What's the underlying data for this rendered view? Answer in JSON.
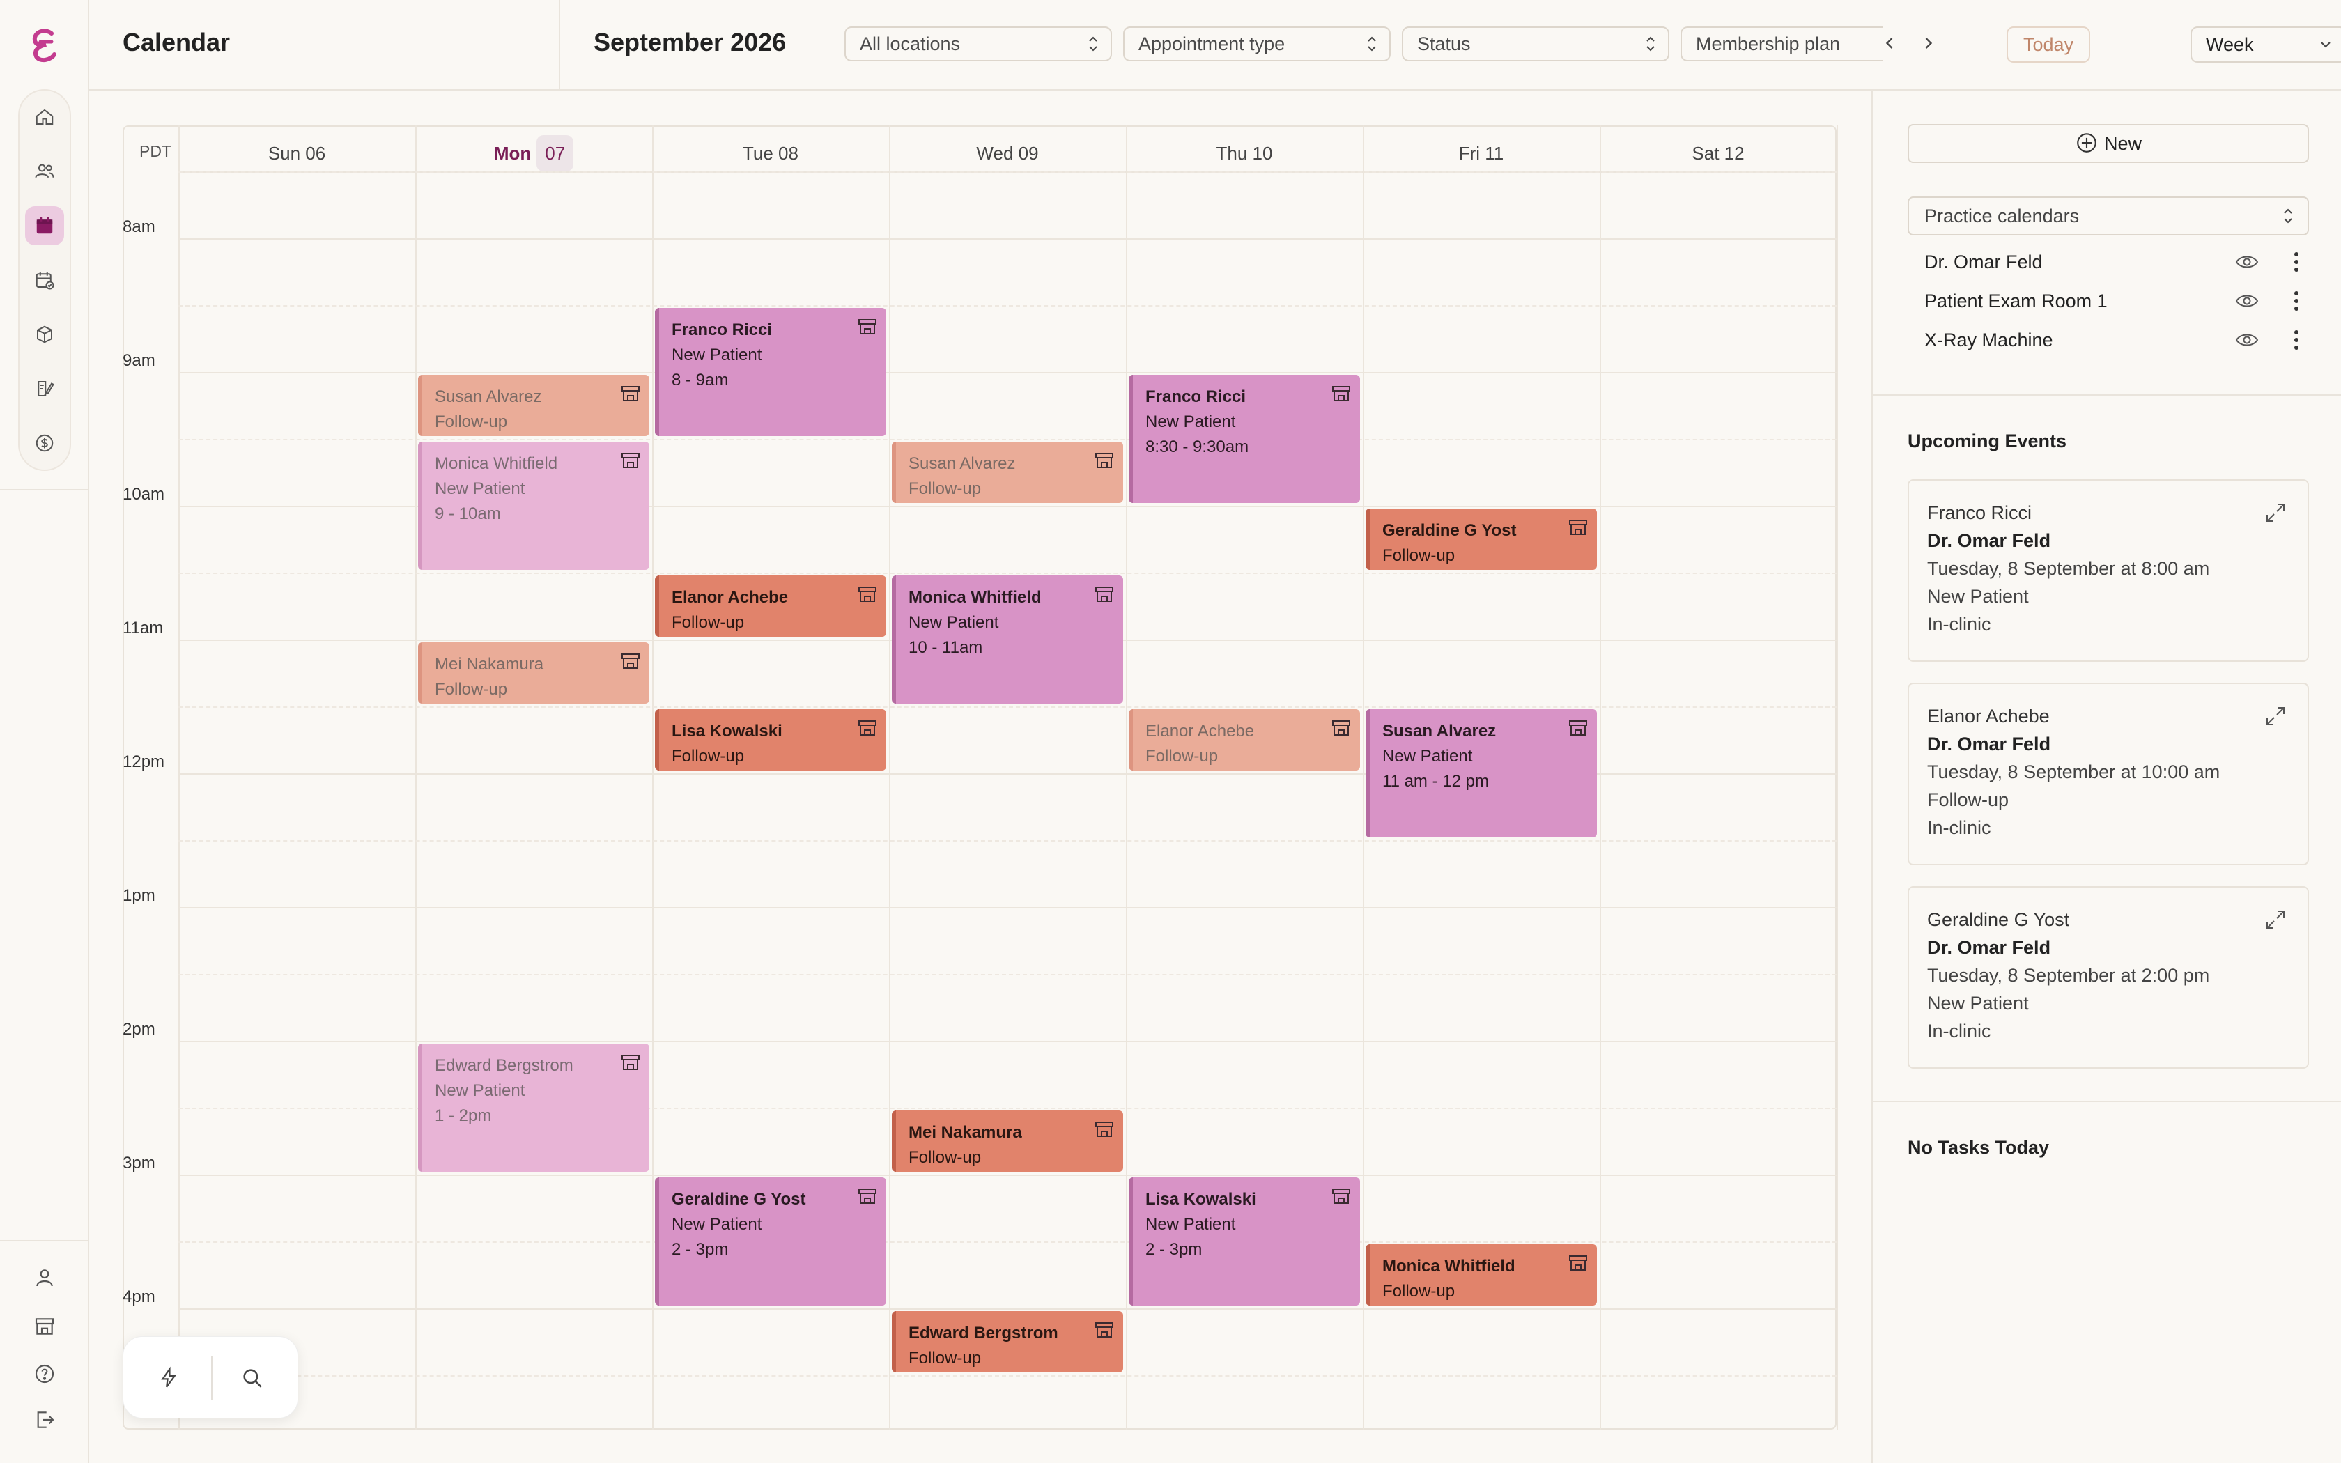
{
  "app": {
    "title": "Calendar"
  },
  "header": {
    "month": "September 2026",
    "filters": [
      "All locations",
      "Appointment type",
      "Status",
      "Membership plan"
    ],
    "today_label": "Today",
    "view_label": "Week"
  },
  "calendar": {
    "timezone": "PDT",
    "days": [
      {
        "label": "Sun 06"
      },
      {
        "label": "Mon",
        "num": "07",
        "today": true
      },
      {
        "label": "Tue 08"
      },
      {
        "label": "Wed 09"
      },
      {
        "label": "Thu 10"
      },
      {
        "label": "Fri 11"
      },
      {
        "label": "Sat 12"
      }
    ],
    "hours": [
      "8am",
      "9am",
      "10am",
      "11am",
      "12pm",
      "1pm",
      "2pm",
      "3pm",
      "4pm"
    ],
    "events": [
      {
        "day": 1,
        "start": 9.0,
        "end": 9.5,
        "name": "Susan Alvarez",
        "type": "Follow-up",
        "time": "",
        "style": "faded-orange"
      },
      {
        "day": 1,
        "start": 9.5,
        "end": 10.5,
        "name": "Monica Whitfield",
        "type": "New Patient",
        "time": "9 - 10am",
        "style": "faded-pink"
      },
      {
        "day": 1,
        "start": 11.0,
        "end": 11.5,
        "name": "Mei Nakamura",
        "type": "Follow-up",
        "time": "",
        "style": "faded-orange"
      },
      {
        "day": 1,
        "start": 14.0,
        "end": 15.0,
        "name": "Edward Bergstrom",
        "type": "New Patient",
        "time": "1 - 2pm",
        "style": "faded-pink"
      },
      {
        "day": 2,
        "start": 8.5,
        "end": 9.5,
        "name": "Franco Ricci",
        "type": "New Patient",
        "time": "8 - 9am",
        "style": "pink"
      },
      {
        "day": 2,
        "start": 10.5,
        "end": 11.0,
        "name": "Elanor Achebe",
        "type": "Follow-up",
        "time": "",
        "style": "orange"
      },
      {
        "day": 2,
        "start": 11.5,
        "end": 12.0,
        "name": "Lisa Kowalski",
        "type": "Follow-up",
        "time": "",
        "style": "orange"
      },
      {
        "day": 2,
        "start": 15.0,
        "end": 16.0,
        "name": "Geraldine G Yost",
        "type": "New Patient",
        "time": "2 - 3pm",
        "style": "pink"
      },
      {
        "day": 3,
        "start": 9.5,
        "end": 10.0,
        "name": "Susan Alvarez",
        "type": "Follow-up",
        "time": "",
        "style": "faded-orange"
      },
      {
        "day": 3,
        "start": 10.5,
        "end": 11.5,
        "name": "Monica Whitfield",
        "type": "New Patient",
        "time": "10 - 11am",
        "style": "pink"
      },
      {
        "day": 3,
        "start": 14.5,
        "end": 15.0,
        "name": "Mei Nakamura",
        "type": "Follow-up",
        "time": "",
        "style": "orange"
      },
      {
        "day": 3,
        "start": 16.0,
        "end": 16.5,
        "name": "Edward Bergstrom",
        "type": "Follow-up",
        "time": "",
        "style": "orange"
      },
      {
        "day": 4,
        "start": 9.0,
        "end": 10.0,
        "name": "Franco Ricci",
        "type": "New Patient",
        "time": "8:30 - 9:30am",
        "style": "pink"
      },
      {
        "day": 4,
        "start": 11.5,
        "end": 12.0,
        "name": "Elanor Achebe",
        "type": "Follow-up",
        "time": "",
        "style": "faded-orange"
      },
      {
        "day": 4,
        "start": 15.0,
        "end": 16.0,
        "name": "Lisa Kowalski",
        "type": "New Patient",
        "time": "2 - 3pm",
        "style": "pink"
      },
      {
        "day": 5,
        "start": 10.0,
        "end": 10.5,
        "name": "Geraldine G Yost",
        "type": "Follow-up",
        "time": "",
        "style": "orange"
      },
      {
        "day": 5,
        "start": 11.5,
        "end": 12.5,
        "name": "Susan Alvarez",
        "type": "New Patient",
        "time": "11 am - 12 pm",
        "style": "pink"
      },
      {
        "day": 5,
        "start": 15.5,
        "end": 16.0,
        "name": "Monica Whitfield",
        "type": "Follow-up",
        "time": "",
        "style": "orange"
      }
    ]
  },
  "sidebar": {
    "new_label": "New",
    "practice_select": "Practice calendars",
    "calendars": [
      "Dr. Omar Feld",
      "Patient Exam Room 1",
      "X-Ray Machine"
    ],
    "upcoming_title": "Upcoming Events",
    "upcoming": [
      {
        "name": "Franco Ricci",
        "doctor": "Dr. Omar Feld",
        "when": "Tuesday, 8 September at 8:00 am",
        "type": "New Patient",
        "location": "In-clinic"
      },
      {
        "name": "Elanor Achebe",
        "doctor": "Dr. Omar Feld",
        "when": "Tuesday, 8 September at 10:00 am",
        "type": "Follow-up",
        "location": "In-clinic"
      },
      {
        "name": "Geraldine G Yost",
        "doctor": "Dr. Omar Feld",
        "when": "Tuesday, 8 September at 2:00 pm",
        "type": "New Patient",
        "location": "In-clinic"
      }
    ],
    "tasks_label": "No Tasks Today"
  },
  "colors": {
    "accent": "#7a1f57",
    "event_pink": "#d893c6",
    "event_orange": "#e1836b",
    "event_pink_faded": "#e8b4d6",
    "event_orange_faded": "#eaac98"
  },
  "icons": {
    "nav": [
      "home-icon",
      "patients-icon",
      "calendar-icon",
      "schedule-check-icon",
      "package-icon",
      "clipboard-edit-icon",
      "billing-icon"
    ],
    "nav_bottom": [
      "profile-icon",
      "store-icon",
      "help-icon",
      "logout-icon"
    ]
  }
}
